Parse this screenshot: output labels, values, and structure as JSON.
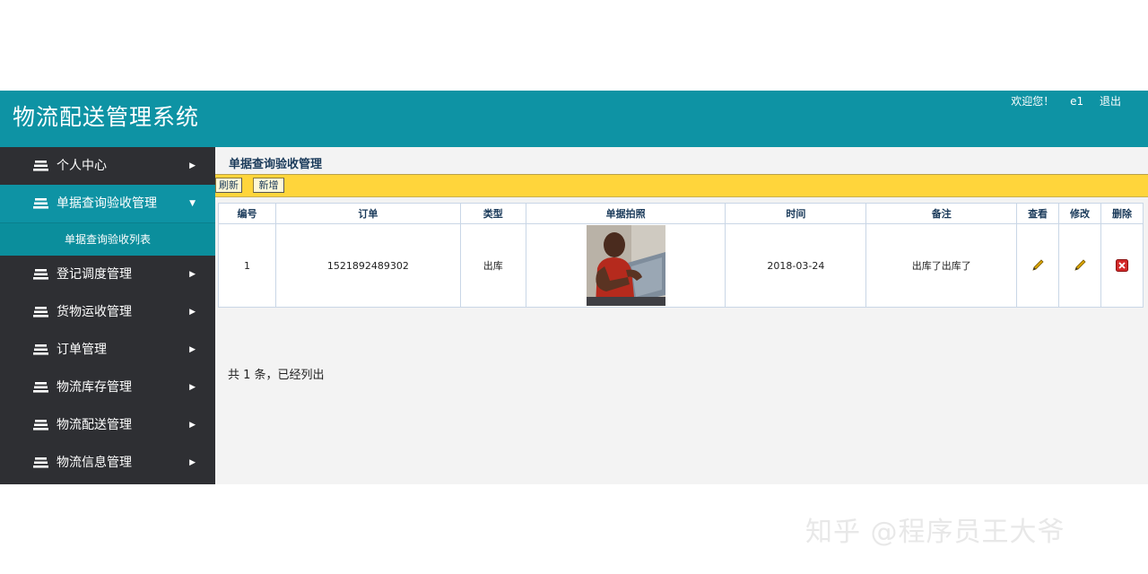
{
  "header": {
    "title": "物流配送管理系统",
    "welcome": "欢迎您！",
    "username": "e1",
    "logout": "退出"
  },
  "sidebar": {
    "items": [
      {
        "label": "个人中心"
      },
      {
        "label": "单据查询验收管理",
        "expanded": true,
        "sub": [
          {
            "label": "单据查询验收列表"
          }
        ]
      },
      {
        "label": "登记调度管理"
      },
      {
        "label": "货物运收管理"
      },
      {
        "label": "订单管理"
      },
      {
        "label": "物流库存管理"
      },
      {
        "label": "物流配送管理"
      },
      {
        "label": "物流信息管理"
      }
    ]
  },
  "content": {
    "title": "单据查询验收管理",
    "toolbar": {
      "refresh": "刷新",
      "add": "新增"
    },
    "table": {
      "headers": [
        "编号",
        "订单",
        "类型",
        "单据拍照",
        "时间",
        "备注",
        "查看",
        "修改",
        "删除"
      ],
      "rows": [
        {
          "id": "1",
          "order": "1521892489302",
          "type": "出库",
          "time": "2018-03-24",
          "note": "出库了出库了"
        }
      ]
    },
    "summary": "共 1 条，已经列出"
  },
  "watermark": "知乎 @程序员王大爷",
  "colors": {
    "accent": "#0e93a4",
    "sidebar": "#2e2f33",
    "toolbar": "#ffd53b"
  }
}
